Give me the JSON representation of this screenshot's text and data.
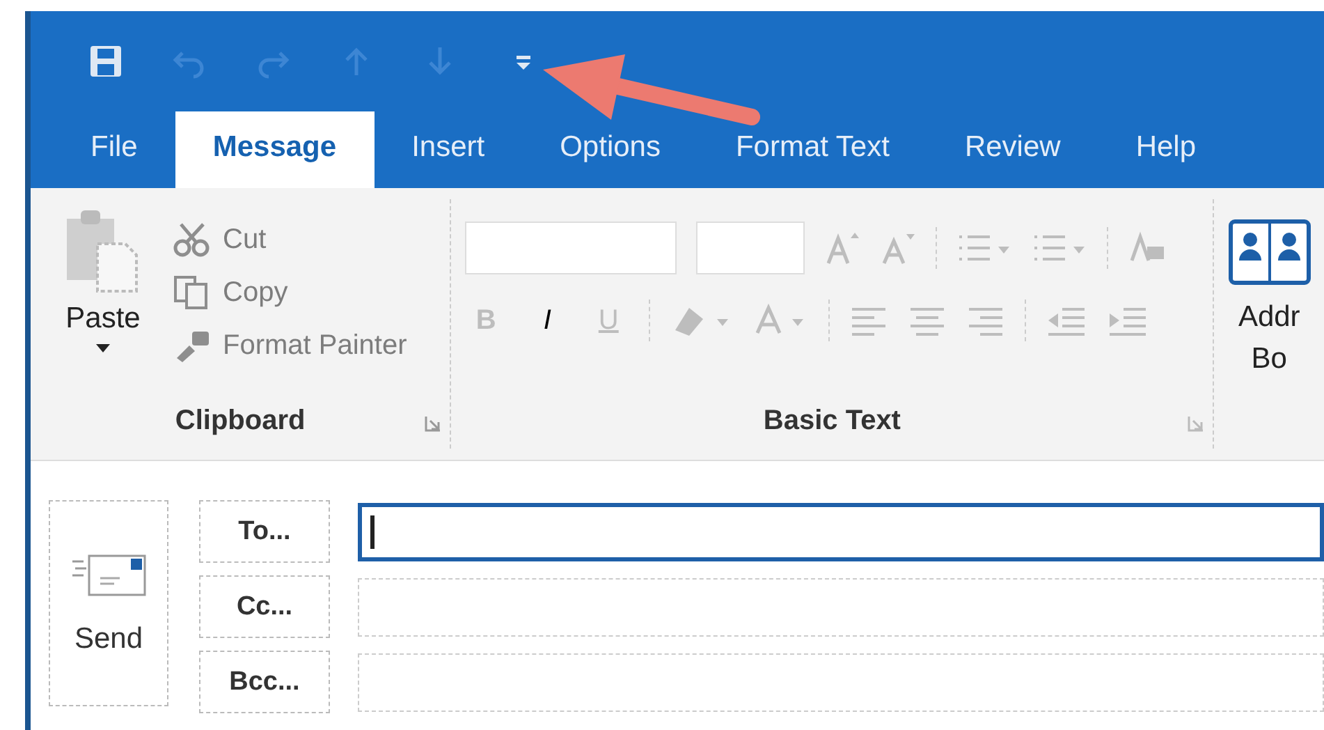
{
  "quick_access": [
    {
      "kind": "save",
      "disabled": false
    },
    {
      "kind": "undo",
      "disabled": true
    },
    {
      "kind": "redo",
      "disabled": true
    },
    {
      "kind": "up",
      "disabled": true
    },
    {
      "kind": "down",
      "disabled": true
    },
    {
      "kind": "customize",
      "disabled": false
    }
  ],
  "tabs": [
    {
      "label": "File",
      "selected": false
    },
    {
      "label": "Message",
      "selected": true
    },
    {
      "label": "Insert",
      "selected": false
    },
    {
      "label": "Options",
      "selected": false
    },
    {
      "label": "Format Text",
      "selected": false
    },
    {
      "label": "Review",
      "selected": false
    },
    {
      "label": "Help",
      "selected": false
    }
  ],
  "ribbon": {
    "clipboard": {
      "paste": {
        "label": "Paste",
        "disabled": false
      },
      "items": [
        {
          "kind": "cut",
          "label": "Cut",
          "disabled": true
        },
        {
          "kind": "copy",
          "label": "Copy",
          "disabled": true
        },
        {
          "kind": "format-painter",
          "label": "Format Painter",
          "disabled": true
        }
      ],
      "group_label": "Clipboard"
    },
    "basic_text": {
      "disabled": true,
      "format_buttons": [
        {
          "kind": "bold",
          "label": "B"
        },
        {
          "kind": "italic",
          "label": "I"
        },
        {
          "kind": "underline",
          "label": "U"
        }
      ],
      "group_label": "Basic Text"
    },
    "address_book": {
      "label_lines": [
        "Addr",
        "Bo"
      ]
    }
  },
  "compose": {
    "send": {
      "label": "Send"
    },
    "recipients": [
      {
        "label": "To...",
        "focused": true
      },
      {
        "label": "Cc...",
        "focused": false
      },
      {
        "label": "Bcc...",
        "focused": false
      }
    ]
  }
}
